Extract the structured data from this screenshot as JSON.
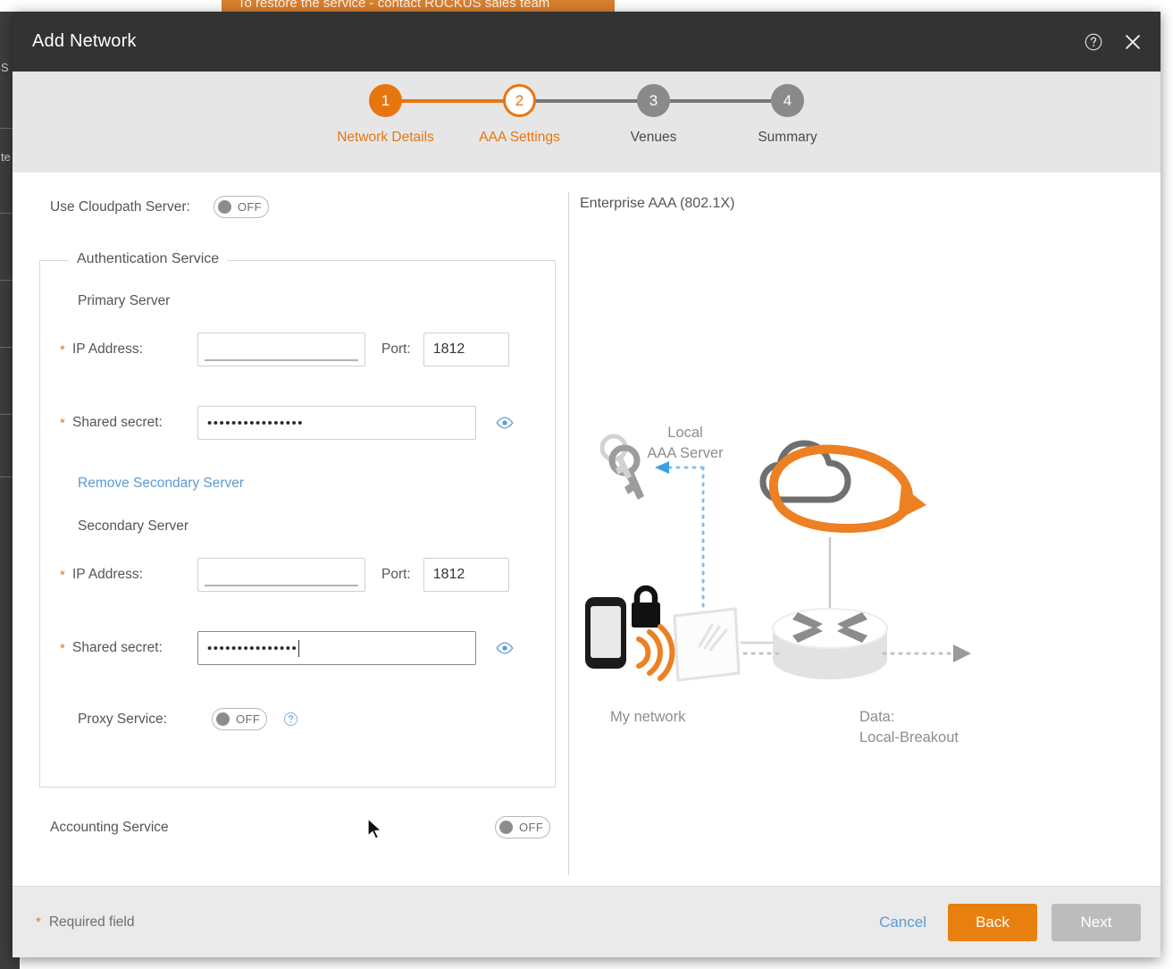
{
  "background": {
    "banner_text": "To restore the service - contact RUCKUS sales team",
    "left_edge_text_1": "S",
    "left_edge_text_2": "te"
  },
  "modal": {
    "title": "Add Network",
    "help_icon": "help-circle-icon",
    "close_icon": "close-icon"
  },
  "stepper": {
    "steps": [
      {
        "number": "1",
        "label": "Network Details",
        "state": "done"
      },
      {
        "number": "2",
        "label": "AAA Settings",
        "state": "active"
      },
      {
        "number": "3",
        "label": "Venues",
        "state": "todo"
      },
      {
        "number": "4",
        "label": "Summary",
        "state": "todo"
      }
    ]
  },
  "form": {
    "cloudpath": {
      "label": "Use Cloudpath Server:",
      "toggle_state": "OFF"
    },
    "auth_service": {
      "legend": "Authentication Service",
      "primary": {
        "heading": "Primary Server",
        "ip_label": "IP Address:",
        "ip_value": "",
        "ip_placeholder": "",
        "port_label": "Port:",
        "port_value": "1812",
        "secret_label": "Shared secret:",
        "secret_masked": "••••••••••••••••",
        "eye_icon": "eye-icon"
      },
      "remove_secondary_link": "Remove Secondary Server",
      "secondary": {
        "heading": "Secondary Server",
        "ip_label": "IP Address:",
        "ip_value": "",
        "ip_placeholder": "",
        "port_label": "Port:",
        "port_value": "1812",
        "secret_label": "Shared secret:",
        "secret_masked": "•••••••••••••••",
        "eye_icon": "eye-icon"
      },
      "proxy": {
        "label": "Proxy Service:",
        "toggle_state": "OFF",
        "info_icon": "help-circle-icon"
      }
    },
    "accounting": {
      "label": "Accounting Service",
      "toggle_state": "OFF"
    }
  },
  "diagram": {
    "title": "Enterprise AAA (802.1X)",
    "label_local_aaa": "Local\nAAA Server",
    "label_local_aaa_line1": "Local",
    "label_local_aaa_line2": "AAA Server",
    "label_my_network": "My network",
    "label_data_line1": "Data:",
    "label_data_line2": "Local-Breakout",
    "icons": {
      "keys": "keys-icon",
      "phone": "mobile-phone-icon",
      "lock": "padlock-icon",
      "wifi": "wifi-signal-icon",
      "access_point": "access-point-icon",
      "cloud": "cloud-icon",
      "router": "router-icon"
    }
  },
  "footer": {
    "required_note": "Required field",
    "required_star": "*",
    "cancel_label": "Cancel",
    "back_label": "Back",
    "next_label": "Next"
  },
  "colors": {
    "accent_orange": "#e8760f",
    "link_blue": "#5b9bd5",
    "header_dark": "#333333",
    "stepper_bg": "#e6e6e6",
    "footer_bg": "#eaeaea"
  }
}
